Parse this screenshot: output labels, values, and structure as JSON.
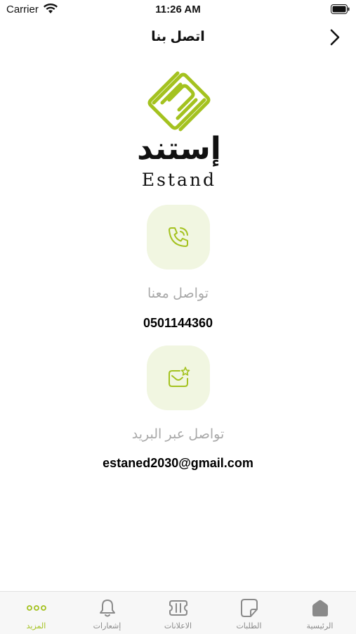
{
  "status_bar": {
    "carrier": "Carrier",
    "time": "11:26 AM"
  },
  "nav": {
    "title": "اتصل بنا"
  },
  "logo": {
    "arabic": "إستند",
    "latin": "Estand"
  },
  "contacts": {
    "phone": {
      "icon": "phone-icon",
      "label": "تواصل معنا",
      "value": "0501144360"
    },
    "email": {
      "icon": "mail-icon",
      "label": "تواصل عبر البريد",
      "value": "estaned2030@gmail.com"
    }
  },
  "tabs": [
    {
      "label": "الرئيسية",
      "icon": "home-icon"
    },
    {
      "label": "الطلبات",
      "icon": "orders-icon"
    },
    {
      "label": "الاعلانات",
      "icon": "ads-icon"
    },
    {
      "label": "إشعارات",
      "icon": "bell-icon"
    },
    {
      "label": "المزيد",
      "icon": "more-icon"
    }
  ],
  "active_tab": "المزيد",
  "colors": {
    "accent": "#a4c21f",
    "tile_bg": "#f1f6e1",
    "label_gray": "#a9a9a9",
    "tab_inactive": "#8a8a8a"
  }
}
